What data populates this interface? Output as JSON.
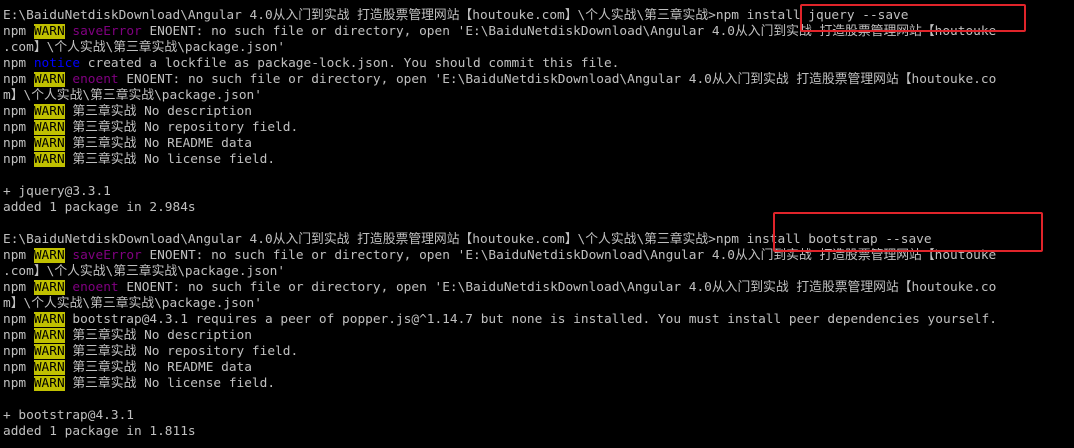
{
  "terminal": {
    "lines": [
      {
        "type": "prompt",
        "path": "E:\\BaiduNetdiskDownload\\Angular 4.0从入门到实战 打造股票管理网站【houtouke.com】\\个人实战\\第三章实战>",
        "command": "npm install jquery --save"
      },
      {
        "type": "npm",
        "prefix": "npm",
        "level": "WARN",
        "tag": "saveError",
        "tagColor": "err",
        "text": " ENOENT: no such file or directory, open 'E:\\BaiduNetdiskDownload\\Angular 4.0从入门到实战 打造股票管理网站【houtouke"
      },
      {
        "type": "plain",
        "text": ".com】\\个人实战\\第三章实战\\package.json'"
      },
      {
        "type": "npm",
        "prefix": "npm",
        "level": "",
        "tag": "notice",
        "tagColor": "notice",
        "text": " created a lockfile as package-lock.json. You should commit this file."
      },
      {
        "type": "npm",
        "prefix": "npm",
        "level": "WARN",
        "tag": "enoent",
        "tagColor": "err",
        "text": " ENOENT: no such file or directory, open 'E:\\BaiduNetdiskDownload\\Angular 4.0从入门到实战 打造股票管理网站【houtouke.co"
      },
      {
        "type": "plain",
        "text": "m】\\个人实战\\第三章实战\\package.json'"
      },
      {
        "type": "npm",
        "prefix": "npm",
        "level": "WARN",
        "tag": "",
        "tagColor": "",
        "text": " 第三章实战 No description"
      },
      {
        "type": "npm",
        "prefix": "npm",
        "level": "WARN",
        "tag": "",
        "tagColor": "",
        "text": " 第三章实战 No repository field."
      },
      {
        "type": "npm",
        "prefix": "npm",
        "level": "WARN",
        "tag": "",
        "tagColor": "",
        "text": " 第三章实战 No README data"
      },
      {
        "type": "npm",
        "prefix": "npm",
        "level": "WARN",
        "tag": "",
        "tagColor": "",
        "text": " 第三章实战 No license field."
      },
      {
        "type": "blank"
      },
      {
        "type": "plain",
        "text": "+ jquery@3.3.1"
      },
      {
        "type": "plain",
        "text": "added 1 package in 2.984s"
      },
      {
        "type": "blank"
      },
      {
        "type": "prompt",
        "path": "E:\\BaiduNetdiskDownload\\Angular 4.0从入门到实战 打造股票管理网站【houtouke.com】\\个人实战\\第三章实战>",
        "command": "npm install bootstrap --save"
      },
      {
        "type": "npm",
        "prefix": "npm",
        "level": "WARN",
        "tag": "saveError",
        "tagColor": "err",
        "text": " ENOENT: no such file or directory, open 'E:\\BaiduNetdiskDownload\\Angular 4.0从入门到实战 打造股票管理网站【houtouke"
      },
      {
        "type": "plain",
        "text": ".com】\\个人实战\\第三章实战\\package.json'"
      },
      {
        "type": "npm",
        "prefix": "npm",
        "level": "WARN",
        "tag": "enoent",
        "tagColor": "err",
        "text": " ENOENT: no such file or directory, open 'E:\\BaiduNetdiskDownload\\Angular 4.0从入门到实战 打造股票管理网站【houtouke.co"
      },
      {
        "type": "plain",
        "text": "m】\\个人实战\\第三章实战\\package.json'"
      },
      {
        "type": "npm",
        "prefix": "npm",
        "level": "WARN",
        "tag": "",
        "tagColor": "",
        "text": " bootstrap@4.3.1 requires a peer of popper.js@^1.14.7 but none is installed. You must install peer dependencies yourself."
      },
      {
        "type": "npm",
        "prefix": "npm",
        "level": "WARN",
        "tag": "",
        "tagColor": "",
        "text": " 第三章实战 No description"
      },
      {
        "type": "npm",
        "prefix": "npm",
        "level": "WARN",
        "tag": "",
        "tagColor": "",
        "text": " 第三章实战 No repository field."
      },
      {
        "type": "npm",
        "prefix": "npm",
        "level": "WARN",
        "tag": "",
        "tagColor": "",
        "text": " 第三章实战 No README data"
      },
      {
        "type": "npm",
        "prefix": "npm",
        "level": "WARN",
        "tag": "",
        "tagColor": "",
        "text": " 第三章实战 No license field."
      },
      {
        "type": "blank"
      },
      {
        "type": "plain",
        "text": "+ bootstrap@4.3.1"
      },
      {
        "type": "plain",
        "text": "added 1 package in 1.811s"
      }
    ]
  },
  "colors": {
    "background": "#000000",
    "text": "#c0c0c0",
    "warn_bg": "#c0c000",
    "notice": "#0000ff",
    "error_tag": "#800080",
    "annotation_box": "#e0242a"
  }
}
